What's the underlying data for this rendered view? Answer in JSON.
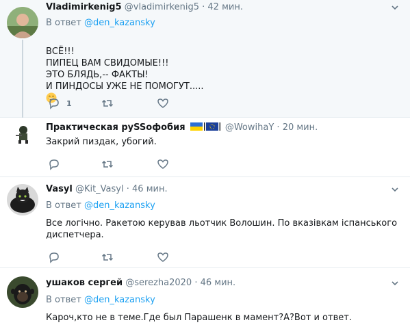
{
  "tweets": [
    {
      "name": "Vladimirkenig5",
      "handle": "@vladimirkenig5",
      "dot": "·",
      "time": "42 мин.",
      "replying_prefix": "В ответ",
      "replying_to": "@den_kazansky",
      "text": "ВСЁ!!!\nПИПЕЦ ВАМ СВИДОМЫЕ!!!\nЭТО БЛЯДЬ,-- ФАКТЫ!\nИ ПИНДОСЫ УЖЕ НЕ ПОМОГУТ.....",
      "reply_count": "1",
      "emoji": "grinning-face-emoji"
    },
    {
      "name": "Практическая руSSофобия",
      "flags_text": "|",
      "handle": "@WowihaY",
      "dot": "·",
      "time": "20 мин.",
      "text": "Закрий пиздак, убогий."
    },
    {
      "name": "Vasyl",
      "handle": "@Kit_Vasyl",
      "dot": "·",
      "time": "46 мин.",
      "replying_prefix": "В ответ",
      "replying_to": "@den_kazansky",
      "text": "Все логічно. Ракетою керував льотчик Волошин. По вказівкам іспанського\nдиспетчера."
    },
    {
      "name": "ушаков сергей",
      "handle": "@serezha2020",
      "dot": "·",
      "time": "46 мин.",
      "replying_prefix": "В ответ",
      "replying_to": "@den_kazansky",
      "text": "Кароч,кто не в теме.Где был Парашенк в мамент?А?Вот и ответ."
    }
  ],
  "icons": {
    "reply": "reply-icon",
    "retweet": "retweet-icon",
    "like": "heart-icon",
    "caret": "chevron-down-icon"
  },
  "colors": {
    "accent": "#1da1f2",
    "muted": "#657786",
    "divider": "#e6ecf0",
    "thread_line": "#ccd6dd",
    "highlight_bg": "#f5f8fa"
  }
}
